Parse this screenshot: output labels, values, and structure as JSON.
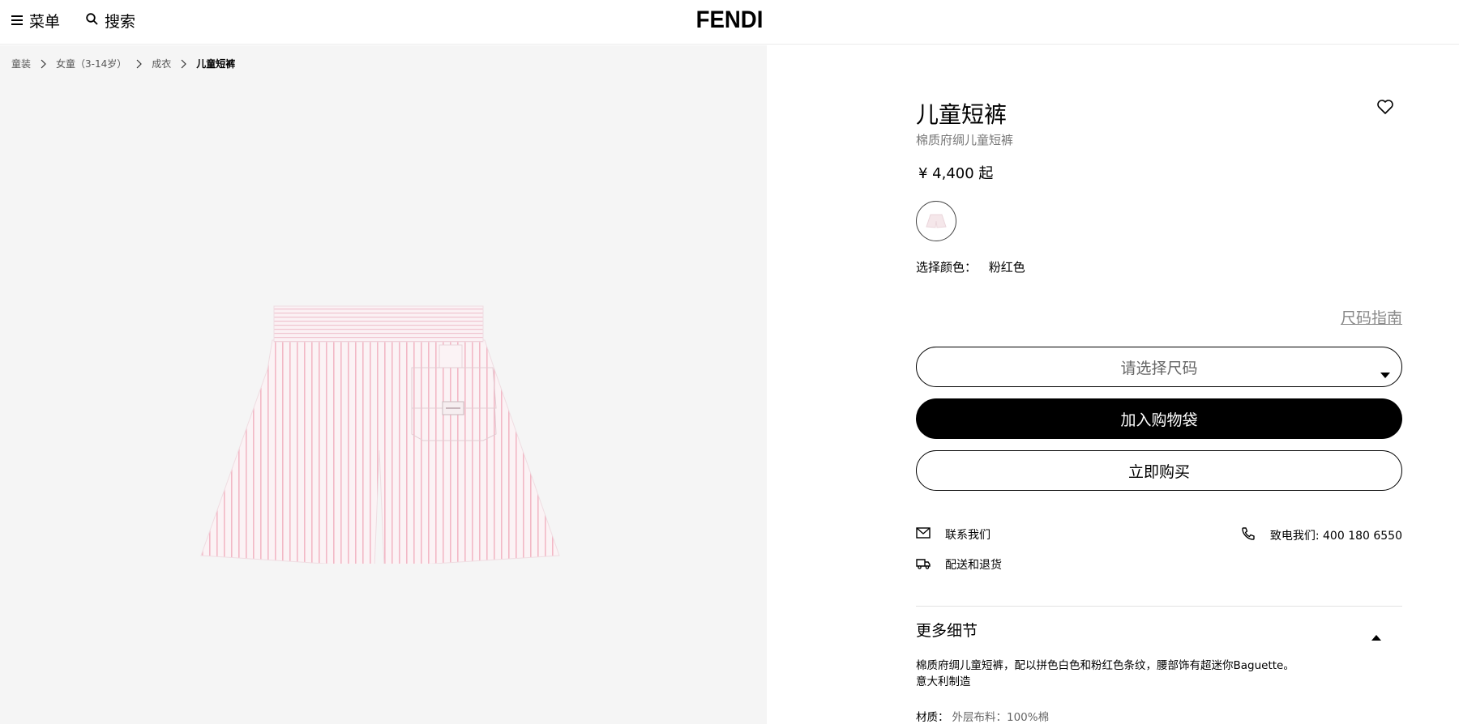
{
  "header": {
    "menu_label": "菜单",
    "search_label": "搜索",
    "logo": "FENDI"
  },
  "breadcrumb": [
    "童装",
    "女童（3-14岁）",
    "成衣",
    "儿童短裤"
  ],
  "product": {
    "title": "儿童短裤",
    "subtitle": "棉质府绸儿童短裤",
    "price": "¥ 4,400 起",
    "color_label": "选择颜色：",
    "color_value": "粉红色",
    "size_guide": "尺码指南",
    "size_placeholder": "请选择尺码",
    "add_to_bag": "加入购物袋",
    "buy_now": "立即购买"
  },
  "services": {
    "contact": "联系我们",
    "delivery": "配送和退货",
    "phone": "致电我们: 400 180 6550"
  },
  "details": {
    "header": "更多细节",
    "description_line1": "棉质府绸儿童短裤，配以拼色白色和粉红色条纹，腰部饰有超迷你Baguette。",
    "description_line2": "意大利制造",
    "material_label": "材质：",
    "material_value": "外层布料：100%棉"
  },
  "colors": {
    "stripe": "#f2b8c6",
    "fabric": "#fbf3f5"
  },
  "icons": [
    "menu-icon",
    "search-icon",
    "heart-icon",
    "chevron-right-icon",
    "caret-down-icon",
    "caret-up-icon",
    "mail-icon",
    "truck-icon",
    "phone-icon"
  ]
}
